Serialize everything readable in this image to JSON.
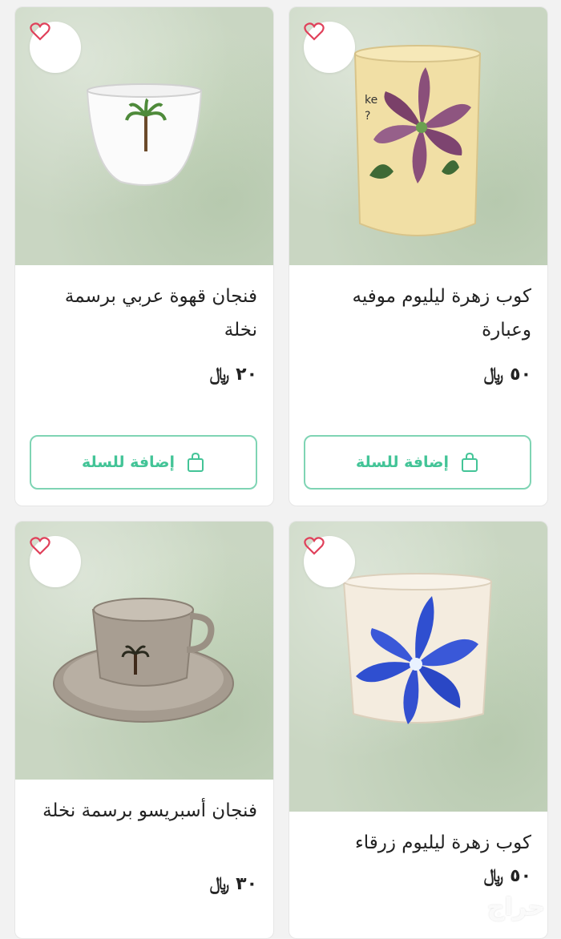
{
  "products": [
    {
      "title": "كوب زهرة ليليوم موفيه وعبارة",
      "price": "٥٠",
      "currency_symbol": "﷼",
      "cart_label": "إضافة للسلة",
      "image": "lilac-lily-mug"
    },
    {
      "title": "فنجان قهوة عربي برسمة نخلة",
      "price": "٢٠",
      "currency_symbol": "﷼",
      "cart_label": "إضافة للسلة",
      "image": "arabic-coffee-cup-palm"
    },
    {
      "title": "كوب زهرة ليليوم زرقاء",
      "price": "٥٠",
      "currency_symbol": "﷼",
      "cart_label": "",
      "image": "blue-lily-mug"
    },
    {
      "title": "فنجان أسبريسو برسمة نخلة",
      "price": "٣٠",
      "currency_symbol": "﷼",
      "cart_label": "",
      "image": "espresso-cup-palm"
    }
  ],
  "icons": {
    "favorite": "heart-icon",
    "cart": "shopping-bag-icon"
  },
  "colors": {
    "accent": "#43c497",
    "heart": "#e0405a"
  },
  "watermark": "حراج"
}
